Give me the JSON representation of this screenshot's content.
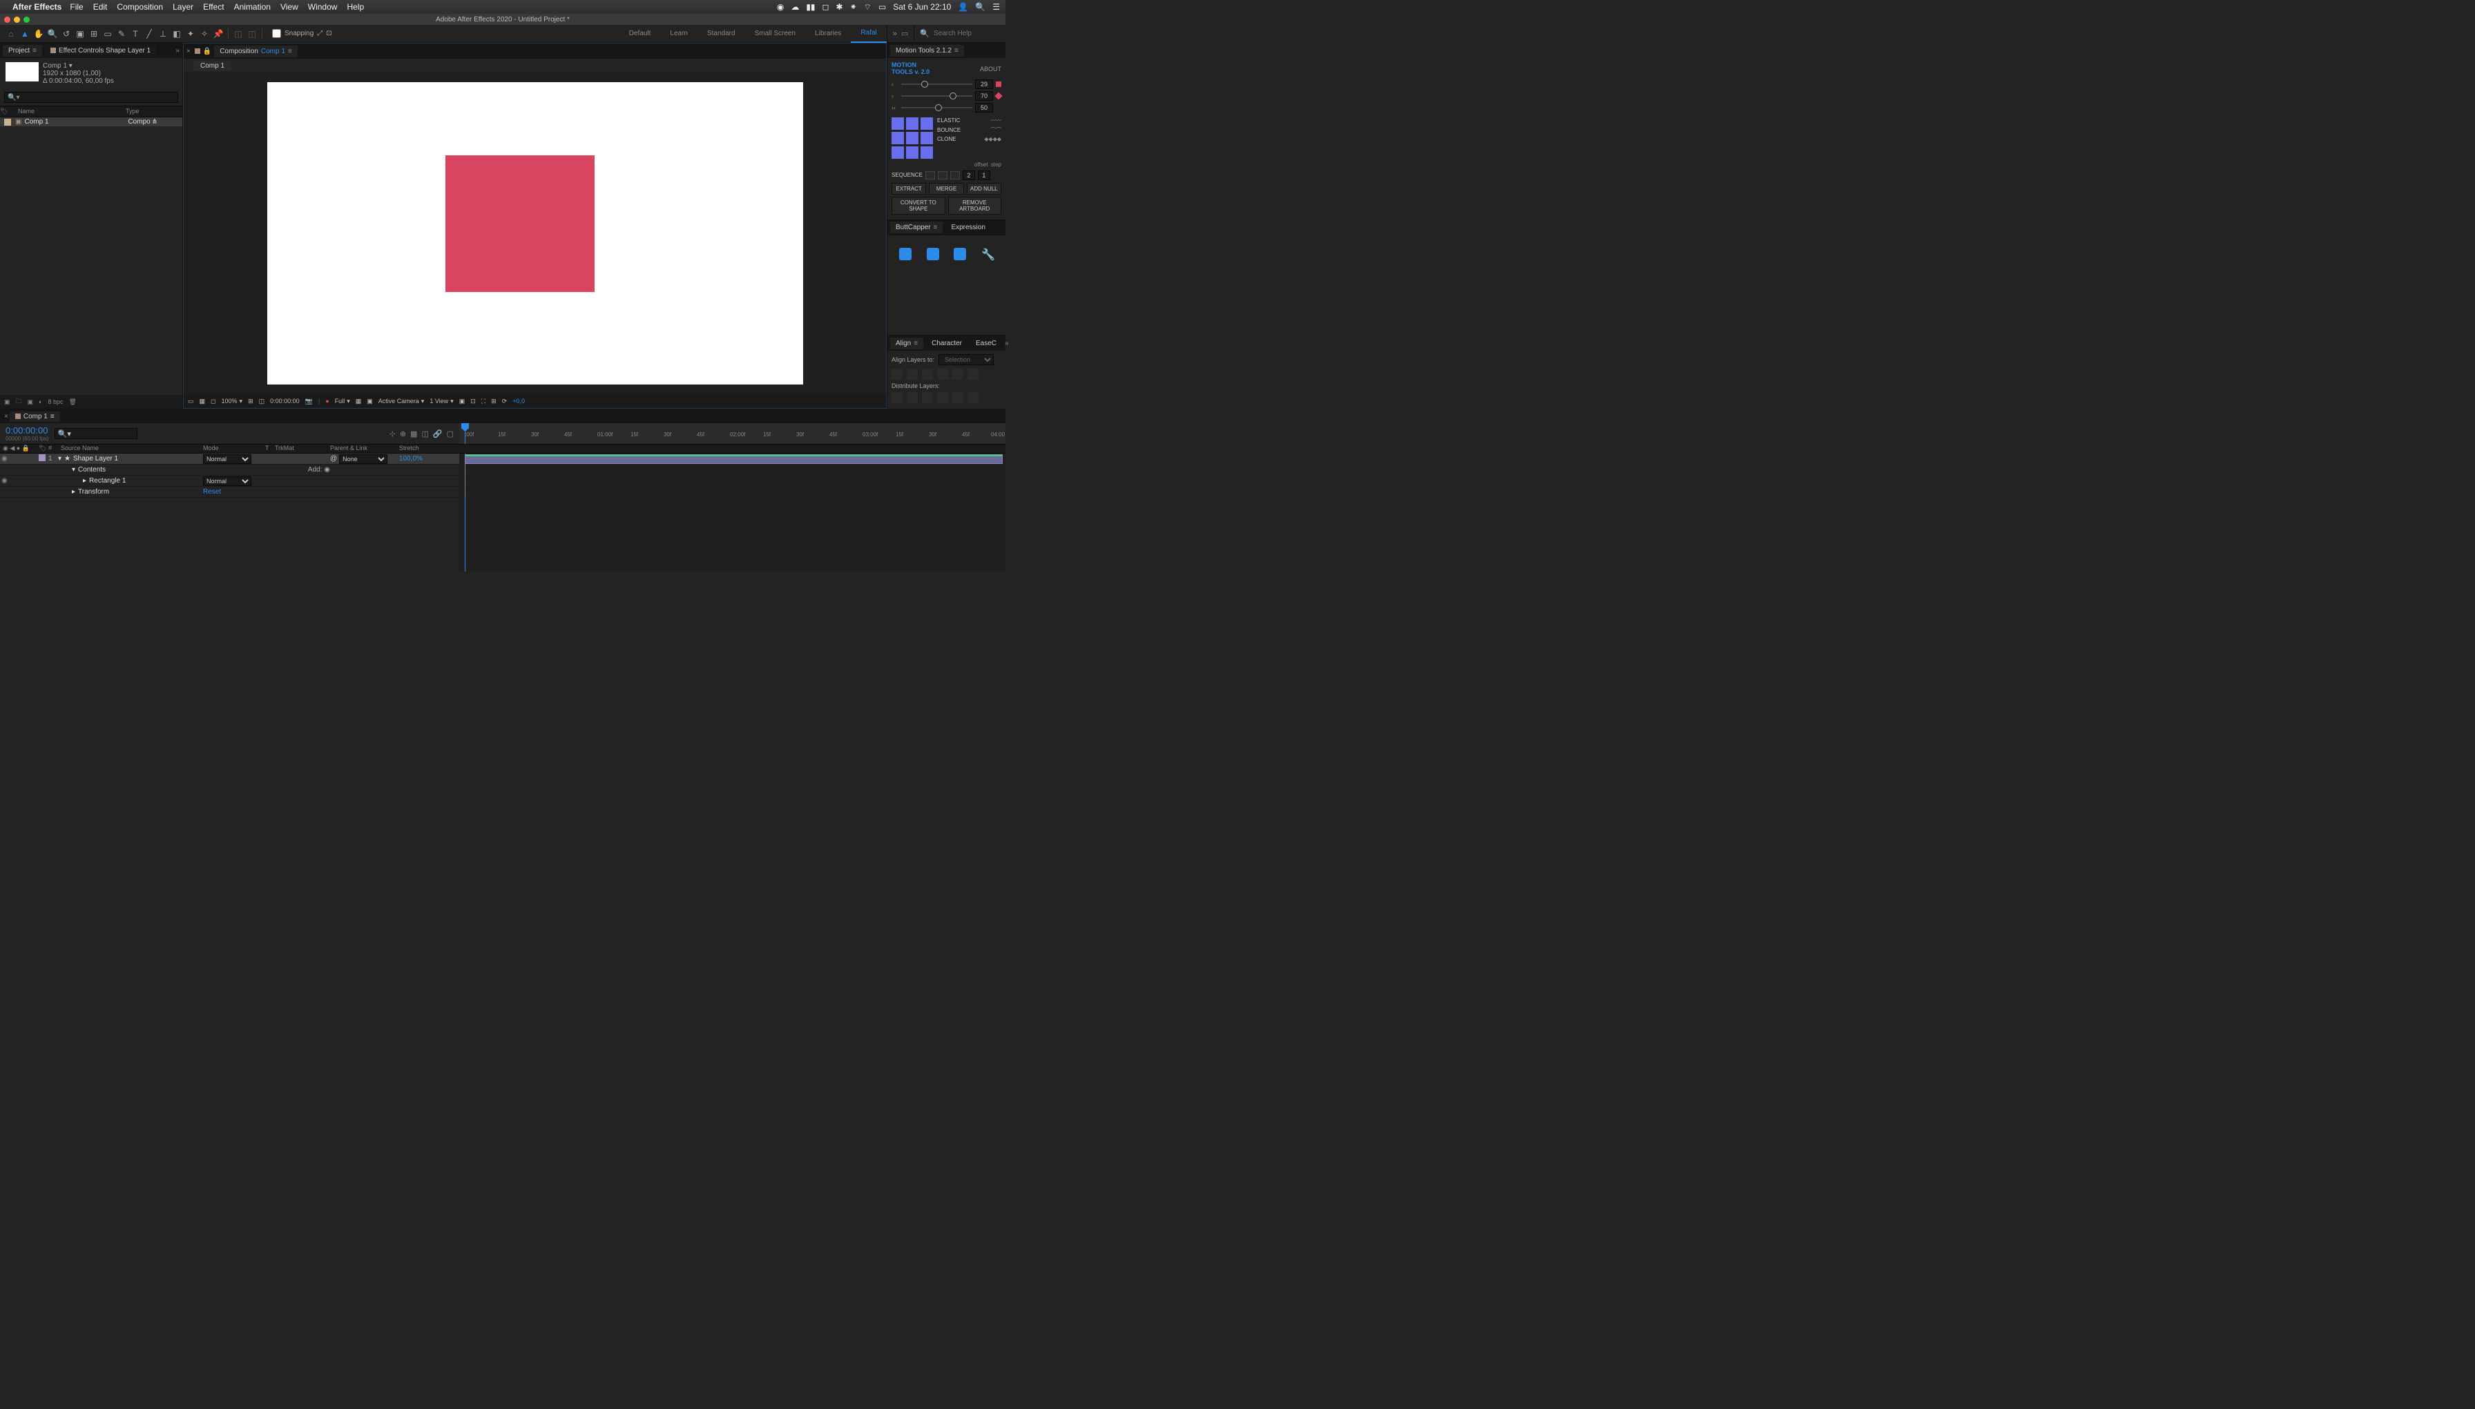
{
  "menubar": {
    "app": "After Effects",
    "items": [
      "File",
      "Edit",
      "Composition",
      "Layer",
      "Effect",
      "Animation",
      "View",
      "Window",
      "Help"
    ],
    "clock": "Sat 6 Jun  22:10"
  },
  "window": {
    "title": "Adobe After Effects 2020 - Untitled Project *"
  },
  "toolbar": {
    "snapping": "Snapping",
    "workspaces": [
      "Default",
      "Learn",
      "Standard",
      "Small Screen",
      "Libraries",
      "Rafal"
    ],
    "active_ws": "Rafal",
    "search_placeholder": "Search Help"
  },
  "project_panel": {
    "tab_project": "Project",
    "tab_effects": "Effect Controls Shape Layer 1",
    "comp_name": "Comp 1 ▾",
    "comp_dims": "1920 x 1080 (1,00)",
    "comp_dur": "Δ 0:00:04:00, 60,00 fps",
    "col_name": "Name",
    "col_type": "Type",
    "row_name": "Comp 1",
    "row_type": "Compo",
    "bpc": "8 bpc"
  },
  "comp_viewer": {
    "tab_label": "Composition",
    "tab_comp": "Comp 1",
    "inner_tab": "Comp 1",
    "footer": {
      "zoom": "100%",
      "time": "0:00:00:00",
      "res": "Full",
      "camera": "Active Camera",
      "views": "1 View",
      "exposure": "+0,0"
    }
  },
  "motion_tools": {
    "title": "Motion Tools 2.1.2",
    "brand1": "MOTION",
    "brand2": "TOOLS v. 2.0",
    "about": "ABOUT",
    "v1": "29",
    "v2": "70",
    "v3": "50",
    "elastic": "ELASTIC",
    "bounce": "BOUNCE",
    "clone": "CLONE",
    "offset": "offset",
    "step": "step",
    "sequence": "SEQUENCE",
    "seq_v1": "2",
    "seq_v2": "1",
    "extract": "EXTRACT",
    "merge": "MERGE",
    "addnull": "ADD NULL",
    "convert": "CONVERT TO SHAPE",
    "remove": "REMOVE ARTBOARD"
  },
  "buttcapper": {
    "tab": "ButtCapper",
    "tab2": "Expression"
  },
  "align": {
    "tab_align": "Align",
    "tab_char": "Character",
    "tab_ease": "EaseC",
    "label": "Align Layers to:",
    "sel": "Selection",
    "dist": "Distribute Layers:"
  },
  "timeline": {
    "tab": "Comp 1",
    "timecode": "0:00:00:00",
    "timecode_sub": "00000 (60.00 fps)",
    "cols": {
      "num": "#",
      "name": "Source Name",
      "mode": "Mode",
      "t": "T",
      "trk": "TrkMat",
      "par": "Parent & Link",
      "str": "Stretch"
    },
    "ticks": [
      ":00f",
      "15f",
      "30f",
      "45f",
      "01:00f",
      "15f",
      "30f",
      "45f",
      "02:00f",
      "15f",
      "30f",
      "45f",
      "03:00f",
      "15f",
      "30f",
      "45f",
      "04:00"
    ],
    "layer": {
      "num": "1",
      "name": "Shape Layer 1",
      "mode": "Normal",
      "par": "None",
      "str": "100,0%",
      "contents": "Contents",
      "add": "Add:",
      "rect": "Rectangle 1",
      "rect_mode": "Normal",
      "transform": "Transform",
      "reset": "Reset"
    }
  }
}
